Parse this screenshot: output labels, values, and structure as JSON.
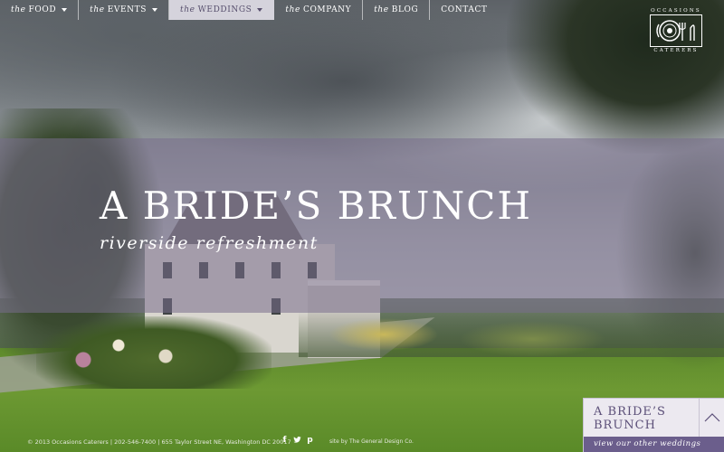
{
  "nav": {
    "items": [
      {
        "prefix": "the",
        "label": "FOOD",
        "dropdown": true,
        "active": false
      },
      {
        "prefix": "the",
        "label": "EVENTS",
        "dropdown": true,
        "active": false
      },
      {
        "prefix": "the",
        "label": "WEDDINGS",
        "dropdown": true,
        "active": true
      },
      {
        "prefix": "the",
        "label": "COMPANY",
        "dropdown": false,
        "active": false
      },
      {
        "prefix": "the",
        "label": "BLOG",
        "dropdown": false,
        "active": false
      },
      {
        "prefix": "",
        "label": "CONTACT",
        "dropdown": false,
        "active": false
      }
    ],
    "active_bg": "#d5d3dc",
    "active_text": "#574f6d"
  },
  "logo": {
    "top_text": "OCCASIONS",
    "bottom_text": "CATERERS"
  },
  "hero": {
    "title": "A BRIDE’S BRUNCH",
    "subtitle": "riverside refreshment",
    "band_color": "#786e8c"
  },
  "footer": {
    "info": "© 2013 Occasions Caterers | 202-546-7400 | 655 Taylor Street NE, Washington DC 20017",
    "social_icons": [
      "facebook-icon",
      "twitter-icon",
      "pinterest-icon"
    ],
    "social_glyphs": [
      "f",
      "🐦",
      "p"
    ],
    "credit": "site by The General Design Co."
  },
  "card": {
    "title": "A BRIDE’S BRUNCH",
    "link_text": "view our other weddings",
    "toggle_icon": "chevron-up-icon",
    "accent": "#6b5e8c"
  }
}
